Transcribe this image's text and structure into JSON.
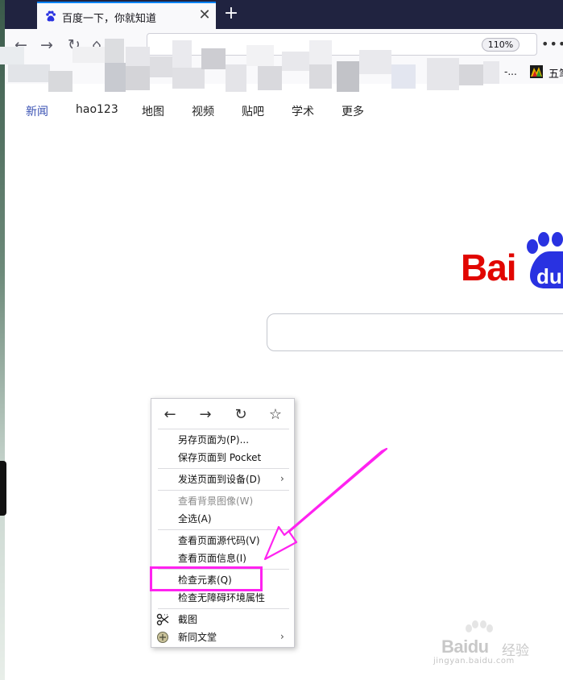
{
  "browser": {
    "tab_title": "百度一下，你就知道",
    "tab_close": "✕",
    "new_tab": "+",
    "zoom": "110%",
    "menu": "•••",
    "back": "←",
    "forward": "→",
    "reload": "↻",
    "home": "⌂",
    "bookmarks": {
      "ellipsis": "-...",
      "label": "五笔"
    }
  },
  "topnav": [
    "新闻",
    "hao123",
    "地图",
    "视频",
    "贴吧",
    "学术",
    "更多"
  ],
  "logo": {
    "text": "Bai",
    "paw_text": "du"
  },
  "context_menu": {
    "nav": {
      "back": "←",
      "forward": "→",
      "reload": "↻",
      "bookmark": "☆"
    },
    "items": [
      {
        "label": "另存页面为(P)...",
        "disabled": false
      },
      {
        "label": "保存页面到 Pocket",
        "disabled": false
      },
      {
        "label": "发送页面到设备(D)",
        "disabled": false,
        "submenu": "›"
      },
      {
        "label": "查看背景图像(W)",
        "disabled": true
      },
      {
        "label": "全选(A)",
        "disabled": false
      },
      {
        "label": "查看页面源代码(V)",
        "disabled": false
      },
      {
        "label": "查看页面信息(I)",
        "disabled": false
      },
      {
        "label": "检查元素(Q)",
        "disabled": false
      },
      {
        "label": "检查无障碍环境属性",
        "disabled": false
      },
      {
        "label": "截图",
        "disabled": false
      },
      {
        "label": "新同文堂",
        "disabled": false,
        "submenu": "›"
      }
    ]
  },
  "watermark": {
    "logo": "Baidu",
    "cn": "经验",
    "url": "jingyan.baidu.com"
  },
  "colors": {
    "highlight": "#ff22f0",
    "baidu_red": "#e10601",
    "baidu_blue": "#2932e1",
    "tabbar": "#202340"
  }
}
